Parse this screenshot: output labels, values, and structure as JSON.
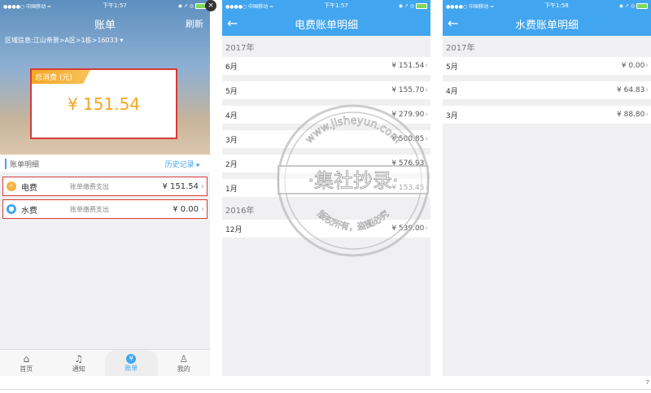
{
  "status": {
    "carrier": "●●●●○ 中国移动",
    "wifi": "≈",
    "icons": "◉ ↗ ◎"
  },
  "screen1": {
    "time": "下午1:57",
    "title": "账单",
    "refresh": "刷新",
    "close": "×",
    "region": "区域信息:江山帝景>A区>1栋>16033 ▾",
    "total_label": "总消费 (元)",
    "total_amount": "¥ 151.54",
    "section_title": "账单明细",
    "history": "历史记录 ▸",
    "rows": [
      {
        "name": "电费",
        "desc": "账单缴费支出",
        "value": "¥ 151.54",
        "icon": "lightning-icon",
        "color": "#f5b342"
      },
      {
        "name": "水费",
        "desc": "账单缴费支出",
        "value": "¥ 0.00",
        "icon": "water-drop-icon",
        "color": "#42a5ef"
      }
    ],
    "tabs": [
      {
        "label": "首页",
        "icon": "home-icon",
        "glyph": "⌂"
      },
      {
        "label": "通知",
        "icon": "bell-icon",
        "glyph": "♫"
      },
      {
        "label": "账单",
        "icon": "bill-icon",
        "glyph": "¥"
      },
      {
        "label": "我的",
        "icon": "user-icon",
        "glyph": "♙"
      }
    ]
  },
  "screen2": {
    "time": "下午1:57",
    "title": "电费账单明细",
    "back": "←",
    "groups": [
      {
        "year": "2017年",
        "rows": [
          {
            "month": "6月",
            "value": "¥ 151.54"
          },
          {
            "month": "5月",
            "value": "¥ 155.70"
          },
          {
            "month": "4月",
            "value": "¥ 279.90"
          },
          {
            "month": "3月",
            "value": "¥ 500.85"
          },
          {
            "month": "2月",
            "value": "¥ 576.93"
          },
          {
            "month": "1月",
            "value": "¥ 153.45"
          }
        ]
      },
      {
        "year": "2016年",
        "rows": [
          {
            "month": "12月",
            "value": "¥ 539.00"
          }
        ]
      }
    ]
  },
  "screen3": {
    "time": "下午1:58",
    "title": "水费账单明细",
    "back": "←",
    "groups": [
      {
        "year": "2017年",
        "rows": [
          {
            "month": "5月",
            "value": "¥ 0.00"
          },
          {
            "month": "4月",
            "value": "¥ 64.83"
          },
          {
            "month": "3月",
            "value": "¥ 88.80"
          }
        ]
      }
    ]
  },
  "watermark": {
    "site": "www.jisheyun.com",
    "main": "·集社抄录·",
    "sub": "版权所有，盗图必究"
  },
  "page_number": "7",
  "chevron": "›"
}
